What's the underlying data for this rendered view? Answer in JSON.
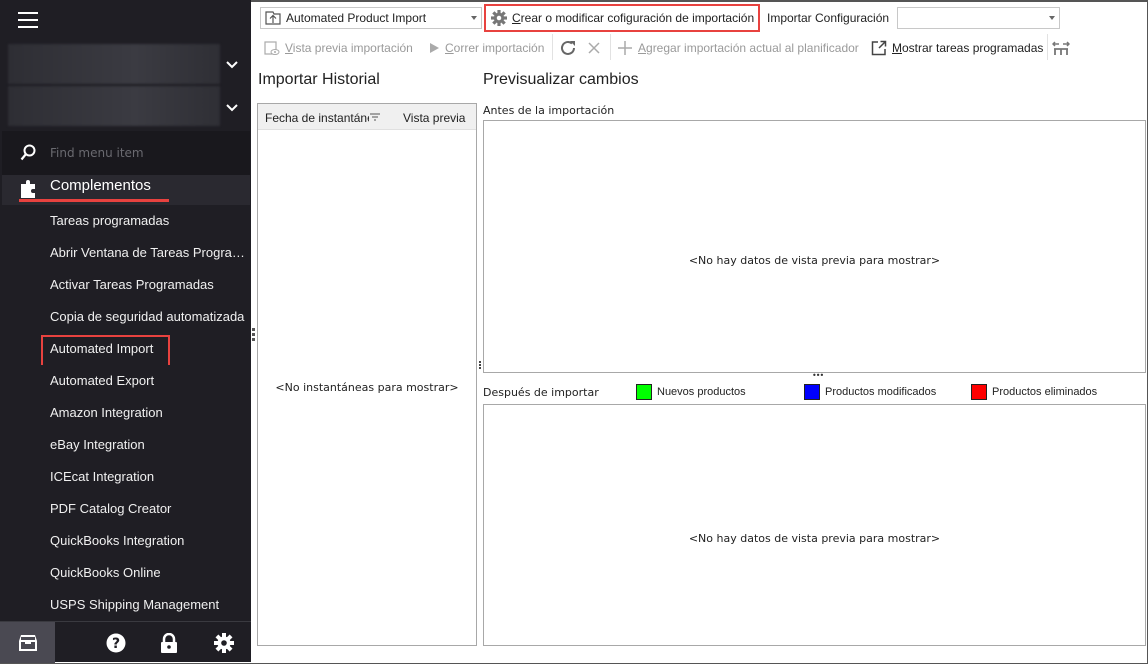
{
  "sidebar": {
    "search_placeholder": "Find menu item",
    "group_label": "Complementos",
    "items": [
      {
        "label": "Tareas programadas"
      },
      {
        "label": "Abrir Ventana de Tareas Programadas"
      },
      {
        "label": "Activar Tareas Programadas"
      },
      {
        "label": "Copia de seguridad automatizada"
      },
      {
        "label": "Automated Import",
        "highlighted": true
      },
      {
        "label": "Automated Export"
      },
      {
        "label": "Amazon Integration"
      },
      {
        "label": "eBay Integration"
      },
      {
        "label": "ICEcat Integration"
      },
      {
        "label": "PDF Catalog Creator"
      },
      {
        "label": "QuickBooks Integration"
      },
      {
        "label": "QuickBooks Online"
      },
      {
        "label": "USPS Shipping Management"
      }
    ],
    "bottom_icons": [
      "archive-icon",
      "help-icon",
      "lock-icon",
      "gear-icon"
    ]
  },
  "toolbar": {
    "profile_value": "Automated Product Import",
    "create_config_label": "Crear o modificar cofiguración de importación",
    "import_config_label": "Importar Configuración",
    "import_config_value": "",
    "preview_import": "Vista previa importación",
    "run_import": "Correr importación",
    "add_to_scheduler": "Agregar importación actual al planificador",
    "show_scheduled": "Mostrar tareas programadas"
  },
  "history": {
    "title": "Importar Historial",
    "col_date": "Fecha de instantánea",
    "col_preview": "Vista previa",
    "empty": "<No instantáneas para mostrar>"
  },
  "preview": {
    "title": "Previsualizar cambios",
    "before_label": "Antes de la importación",
    "before_empty": "<No hay datos de vista previa para mostrar>",
    "after_label": "Después de importar",
    "after_empty": "<No hay datos de vista previa para mostrar>",
    "legend": [
      {
        "label": "Nuevos productos",
        "color": "#00ff00"
      },
      {
        "label": "Productos modificados",
        "color": "#0000ff"
      },
      {
        "label": "Productos eliminados",
        "color": "#ff0000"
      }
    ]
  }
}
